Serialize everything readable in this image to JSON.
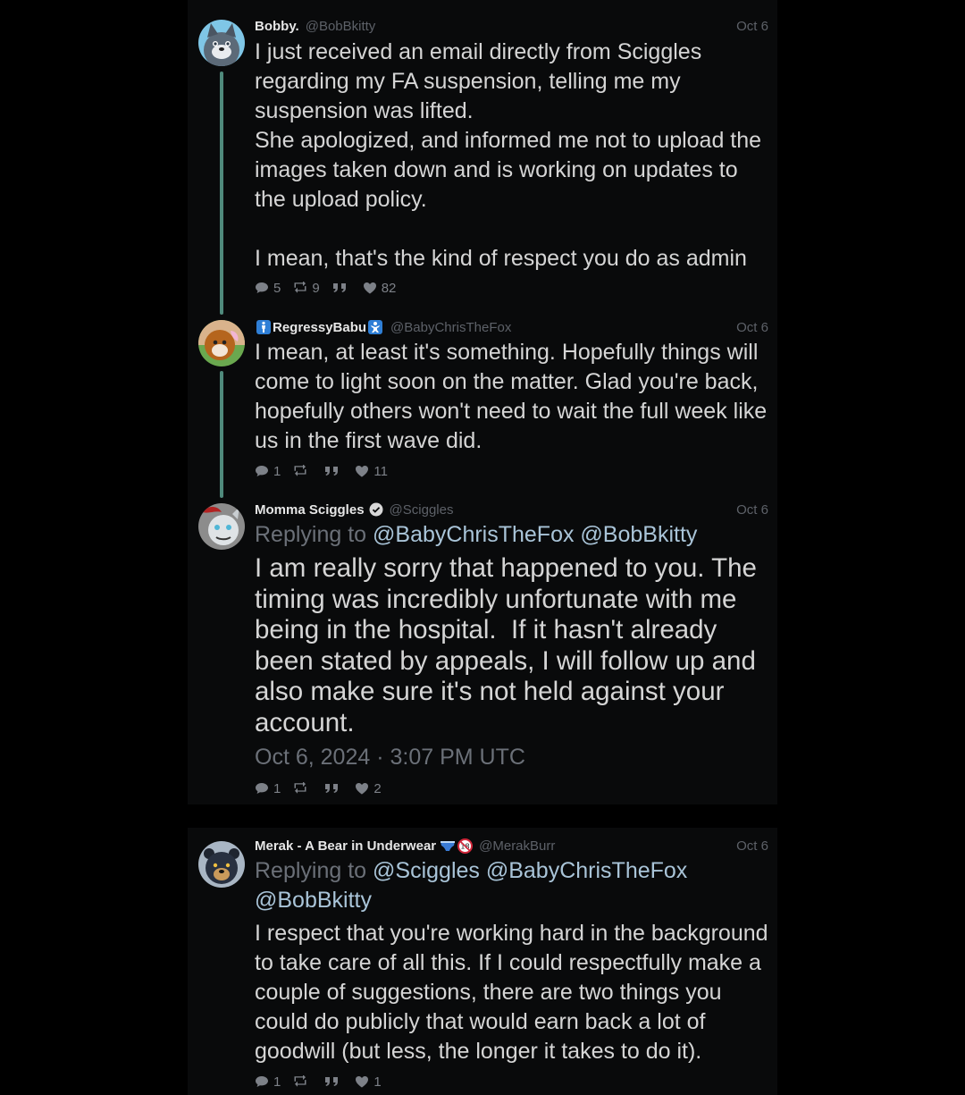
{
  "tweets": [
    {
      "name": "Bobby.",
      "handle": "@BobBkitty",
      "date": "Oct 6",
      "text": "I just received an email directly from Sciggles\nregarding my FA suspension, telling me my\nsuspension was lifted.\nShe apologized, and informed me not to upload the\nimages taken down and is working on updates to\nthe upload policy.\n\nI mean, that's the kind of respect you do as admin",
      "replies": "5",
      "retweets": "9",
      "likes": "82"
    },
    {
      "name": "RegressyBabu",
      "handle": "@BabyChrisTheFox",
      "date": "Oct 6",
      "text": "I mean, at least it's something. Hopefully things will\ncome to light soon on the matter. Glad you're back,\nhopefully others won't need to wait the full week like\nus in the first wave did.",
      "replies": "1",
      "retweets": "",
      "likes": "11"
    },
    {
      "name": "Momma Sciggles",
      "handle": "@Sciggles",
      "date": "Oct 6",
      "replying_label": "Replying to",
      "replying_mentions": "@BabyChrisTheFox @BobBkitty",
      "text": "I am really sorry that happened to you. The\ntiming was incredibly unfortunate with me\nbeing in the hospital.  If it hasn't already\nbeen stated by appeals, I will follow up and\nalso make sure it's not held against your\naccount.",
      "timestamp": "Oct 6, 2024 · 3:07 PM UTC",
      "replies": "1",
      "retweets": "",
      "likes": "2"
    },
    {
      "name": "Merak - A Bear in Underwear",
      "handle": "@MerakBurr",
      "date": "Oct 6",
      "replying_label": "Replying to",
      "replying_mentions_1": "@Sciggles @BabyChrisTheFox",
      "replying_mentions_2": "@BobBkitty",
      "text": "I respect that you're working hard in the background\nto take care of all this. If I could respectfully make a\ncouple of suggestions, there are two things you\ncould do publicly that would earn back a lot of\ngoodwill (but less, the longer it takes to do it).",
      "replies": "1",
      "retweets": "",
      "likes": "1"
    }
  ],
  "icons": {
    "reply": "comment-icon",
    "retweet": "retweet-icon",
    "quote": "quote-icon",
    "like": "heart-icon",
    "verified": "verified-badge-icon",
    "emoji_toilet": "restroom-emoji-icon",
    "emoji_baby": "baby-symbol-emoji-icon",
    "emoji_underwear": "briefs-emoji-icon",
    "emoji_18": "no-under-18-emoji-icon"
  },
  "colors": {
    "page_bg": "#000000",
    "column_bg": "#090a0b",
    "thread_line": "#4f8a7c",
    "mention": "#a9c4d8",
    "muted": "#5d6168"
  }
}
